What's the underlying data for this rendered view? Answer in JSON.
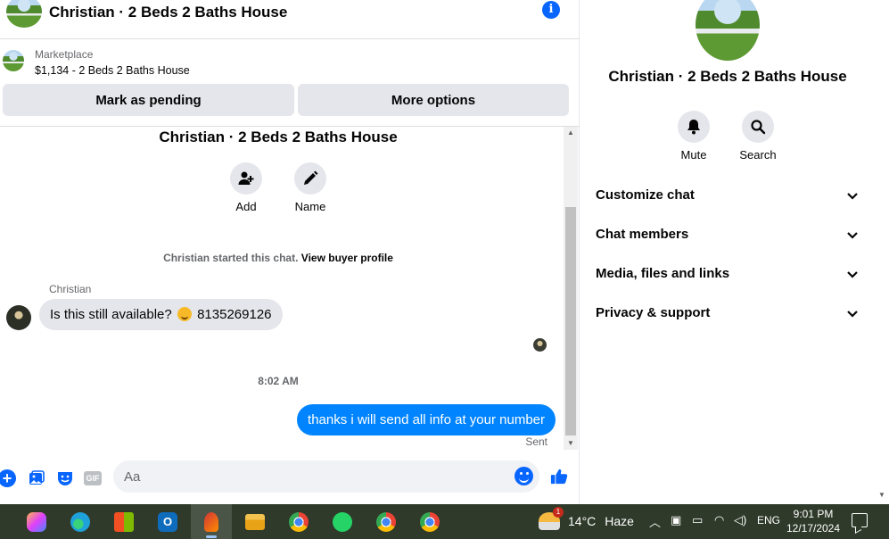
{
  "header": {
    "title": "Christian · 2 Beds 2 Baths House",
    "info_icon": "i"
  },
  "marketplace": {
    "label": "Marketplace",
    "listing": "$1,134 - 2 Beds 2 Baths House",
    "pending_label": "Mark as pending",
    "more_options_label": "More options"
  },
  "conversation": {
    "title": "Christian · 2 Beds 2 Baths House",
    "actions": [
      {
        "label": "Add",
        "icon": "add-person-icon"
      },
      {
        "label": "Name",
        "icon": "pencil-icon"
      }
    ],
    "started_text": "Christian started this chat.",
    "buyer_profile_link": "View buyer profile",
    "sender_name": "Christian",
    "incoming_before_emoji": "Is this still available?",
    "incoming_after_emoji": "8135269126",
    "timestamp": "8:02 AM",
    "outgoing_message": "thanks i will send all info at your number",
    "sent_status": "Sent"
  },
  "composer": {
    "placeholder": "Aa",
    "value": "",
    "gif_label": "GIF"
  },
  "details": {
    "title": "Christian · 2 Beds 2 Baths House",
    "actions": [
      {
        "label": "Mute",
        "icon": "bell-icon"
      },
      {
        "label": "Search",
        "icon": "search-icon"
      }
    ],
    "sections": [
      {
        "label": "Customize chat"
      },
      {
        "label": "Chat members"
      },
      {
        "label": "Media, files and links"
      },
      {
        "label": "Privacy & support"
      }
    ]
  },
  "taskbar": {
    "apps": [
      {
        "name": "copilot",
        "color": "#7b61ff"
      },
      {
        "name": "edge",
        "color": "#1ea2d9"
      },
      {
        "name": "store",
        "color": "#3a86d8"
      },
      {
        "name": "outlook",
        "color": "#0f6cbd"
      },
      {
        "name": "snipping-tool",
        "color": "#d13438"
      },
      {
        "name": "file-explorer",
        "color": "#f2c14e"
      },
      {
        "name": "chrome",
        "color": "#e94235"
      },
      {
        "name": "whatsapp",
        "color": "#25d366"
      },
      {
        "name": "chrome-profile-c",
        "color": "#e94235"
      },
      {
        "name": "chrome-profile-2",
        "color": "#e94235"
      }
    ],
    "weather_badge": "1",
    "weather_temp": "14°C",
    "weather_condition": "Haze",
    "language": "ENG",
    "time": "9:01 PM",
    "date": "12/17/2024"
  }
}
